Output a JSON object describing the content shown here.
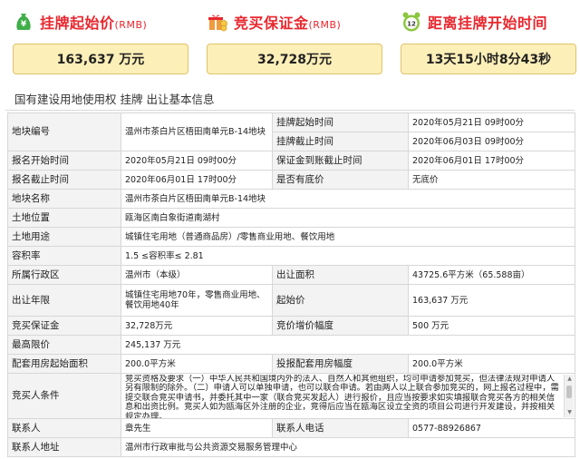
{
  "cards": {
    "start_price": {
      "title": "挂牌起始价",
      "unit": "(RMB)",
      "value": "163,637 万元",
      "icon": "money-bag-icon"
    },
    "deposit": {
      "title": "竞买保证金",
      "unit": "(RMB)",
      "value": "32,728万元",
      "icon": "gift-coins-icon"
    },
    "countdown": {
      "title": "距离挂牌开始时间",
      "value": "13天15小时8分43秒",
      "icon": "alarm-clock-icon"
    }
  },
  "section_title": "国有建设用地使用权 挂牌 出让基本信息",
  "rows": [
    {
      "l1": "地块编号",
      "v1": "温州市茶白片区梧田南单元B-14地块",
      "l2": "挂牌起始时间",
      "v2": "2020年05月21日 09时00分"
    },
    {
      "l1": "",
      "v1": "",
      "l2": "挂牌截止时间",
      "v2": "2020年06月03日 09时00分"
    },
    {
      "l1": "报名开始时间",
      "v1": "2020年05月21日 09时00分",
      "l2": "保证金到账截止时间",
      "v2": "2020年06月01日 17时00分"
    },
    {
      "l1": "报名截止时间",
      "v1": "2020年06月01日 17时00分",
      "l2": "是否有底价",
      "v2": "无底价"
    },
    {
      "l1": "地块名称",
      "v1": "温州市茶白片区梧田南单元B-14地块"
    },
    {
      "l1": "土地位置",
      "v1": "瓯海区南白象街道南湖村"
    },
    {
      "l1": "土地用途",
      "v1": "城镇住宅用地（普通商品房）/零售商业用地、餐饮用地"
    },
    {
      "l1": "容积率",
      "v1": "1.5 ≤容积率≤ 2.81"
    },
    {
      "l1": "所属行政区",
      "v1": "温州市（本级）",
      "l2": "出让面积",
      "v2": "43725.6平方米（65.588亩）"
    },
    {
      "l1": "出让年限",
      "v1": "城镇住宅用地70年，零售商业用地、餐饮用地40年",
      "l2": "起始价",
      "v2": "163,637 万元"
    },
    {
      "l1": "竞买保证金",
      "v1": "32,728万元",
      "l2": "竞价增价幅度",
      "v2": "500 万元"
    },
    {
      "l1": "最高限价",
      "v1": "245,137 万元"
    },
    {
      "l1": "配套用房起始面积",
      "v1": "200.0平方米",
      "l2": "投报配套用房幅度",
      "v2": "200.0平方米"
    },
    {
      "l1": "竞买人条件",
      "v1": "竞买资格及要求（一）中华人民共和国境内外的法人、自然人和其他组织，均可申请参加竞买，但法律法规对申请人另有限制的除外。（二）申请人可以单独申请，也可以联合申请。若由两人以上联合参加竞买的，网上报名过程中，需提交联合竞买申请书，并委托其中一家（联合竞买发起人）进行报价，且应当按要求如实填报联合竞买各方的相关信息和出资比例。竞买人如为瓯海区外注册的企业，竞得后应当在瓯海区设立全资的项目公司进行开发建设，并按相关规定办理。"
    },
    {
      "l1": "联系人",
      "v1": "章先生",
      "l2": "联系人电话",
      "v2": "0577-88926867"
    },
    {
      "l1": "联系人地址",
      "v1": "温州市行政审批与公共资源交易服务管理中心"
    }
  ]
}
